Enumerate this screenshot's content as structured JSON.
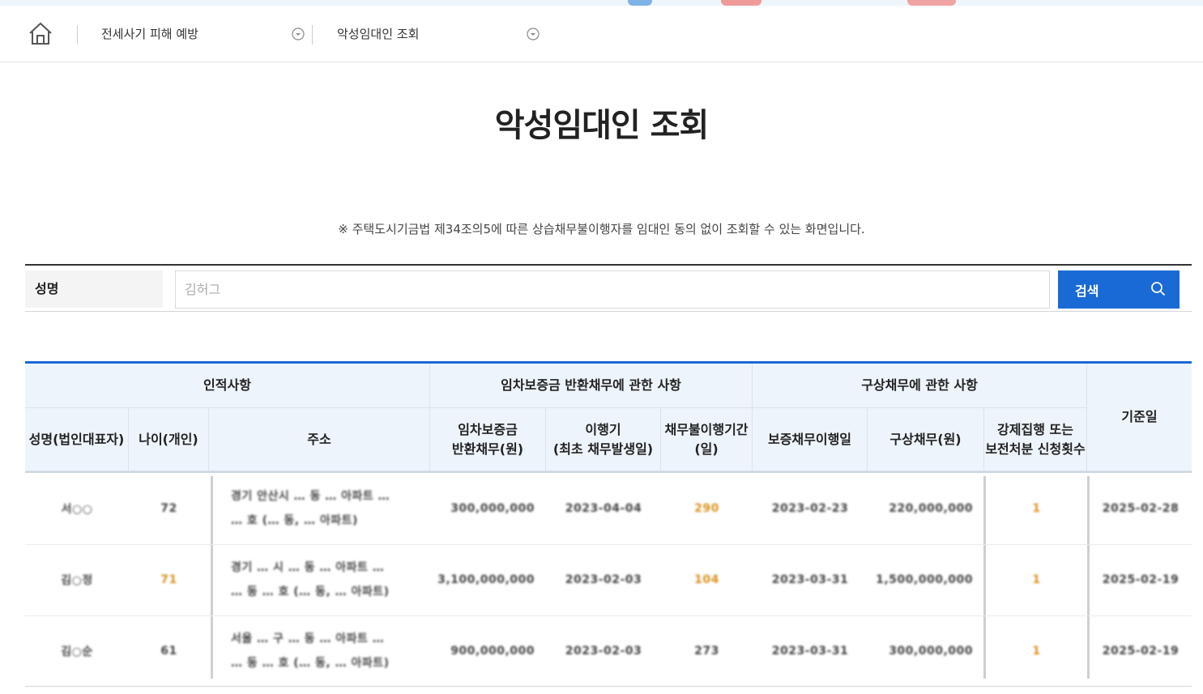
{
  "breadcrumb": {
    "home_icon": "home-icon",
    "items": [
      {
        "label": "전세사기 피해 예방",
        "icon": "chevron-down-circle-icon"
      },
      {
        "label": "악성임대인 조회",
        "icon": "chevron-down-circle-icon"
      }
    ]
  },
  "page": {
    "title": "악성임대인 조회",
    "notice": "※ 주택도시기금법 제34조의5에 따른 상습채무불이행자를 임대인 동의 없이 조회할 수 있는 화면입니다."
  },
  "search": {
    "label": "성명",
    "placeholder": "김허그",
    "button_label": "검색",
    "button_icon": "search-icon"
  },
  "table": {
    "group_headers": [
      "인적사항",
      "임차보증금 반환채무에 관한 사항",
      "구상채무에 관한 사항",
      "기준일"
    ],
    "columns": [
      "성명(법인대표자)",
      "나이(개인)",
      "주소",
      "임차보증금\n반환채무(원)",
      "이행기\n(최초 채무발생일)",
      "채무불이행기간\n(일)",
      "보증채무이행일",
      "구상채무(원)",
      "강제집행 또는\n보전처분 신청횟수"
    ],
    "rows": [
      {
        "name": "서○○",
        "age": "72",
        "address_line1": "경기 안산시 … 동 … 아파트 …",
        "address_line2": "… 호 (… 동, … 아파트)",
        "deposit": "300,000,000",
        "due_date": "2023-04-04",
        "overdue_days": "290",
        "guarantee_date": "2023-02-23",
        "recourse": "220,000,000",
        "enforcement_count": "1",
        "base_date": "2025-02-28"
      },
      {
        "name": "김○정",
        "age": "71",
        "address_line1": "경기 … 시 … 동 … 아파트 …",
        "address_line2": "… 동 … 호 (… 동, … 아파트)",
        "deposit": "3,100,000,000",
        "due_date": "2023-02-03",
        "overdue_days": "104",
        "guarantee_date": "2023-03-31",
        "recourse": "1,500,000,000",
        "enforcement_count": "1",
        "base_date": "2025-02-19"
      },
      {
        "name": "김○순",
        "age": "61",
        "address_line1": "서울 … 구 … 동 … 아파트 …",
        "address_line2": "… 동 … 호 (… 동, … 아파트)",
        "deposit": "900,000,000",
        "due_date": "2023-02-03",
        "overdue_days": "273",
        "guarantee_date": "2023-03-31",
        "recourse": "300,000,000",
        "enforcement_count": "1",
        "base_date": "2025-02-19"
      }
    ]
  },
  "colors": {
    "accent": "#1a6ad6",
    "header_bg": "#eef4fb",
    "count_color": "#d9901a"
  }
}
